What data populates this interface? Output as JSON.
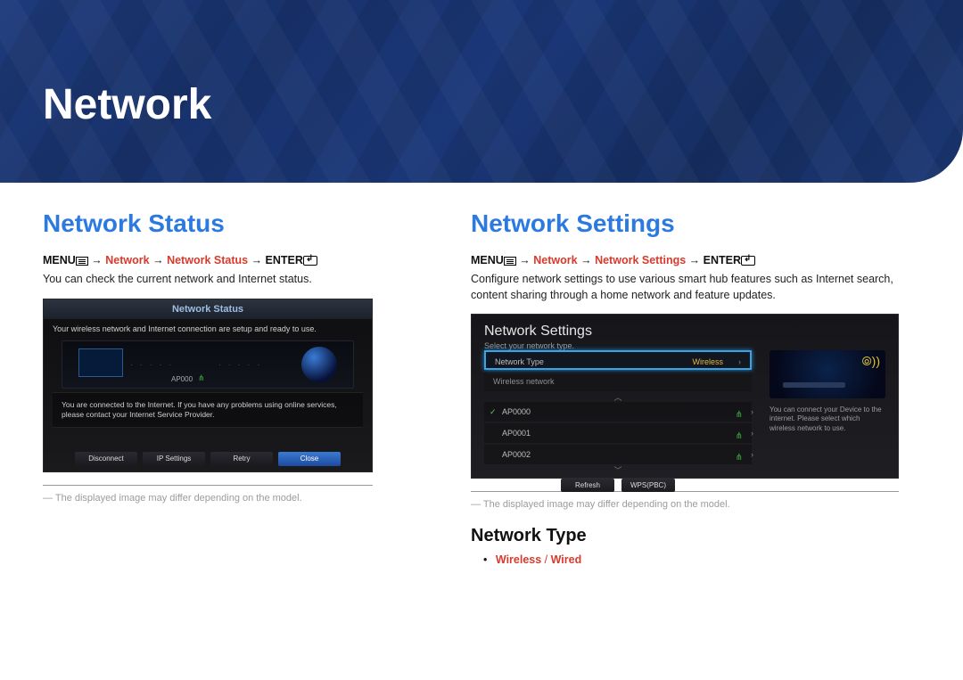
{
  "chapter": {
    "title": "Network"
  },
  "status": {
    "heading": "Network Status",
    "nav": {
      "prefix": "MENU",
      "arrow1": " → ",
      "path1": "Network",
      "arrow2": " → ",
      "path2": "Network Status",
      "arrow3": " → ",
      "suffix": "ENTER"
    },
    "desc": "You can check the current network and Internet status.",
    "screenshot": {
      "title": "Network Status",
      "msg1": "Your wireless network and Internet connection are setup and ready to use.",
      "ap_label": "AP000",
      "msg2": "You are connected to the Internet. If you have any problems using online services, please contact your Internet Service Provider.",
      "buttons": {
        "disconnect": "Disconnect",
        "ip_settings": "IP Settings",
        "retry": "Retry",
        "close": "Close"
      }
    },
    "disclaimer": "― The displayed image may differ depending on the model."
  },
  "settings": {
    "heading": "Network Settings",
    "nav": {
      "prefix": "MENU",
      "arrow1": " → ",
      "path1": "Network",
      "arrow2": " → ",
      "path2": "Network Settings",
      "arrow3": " → ",
      "suffix": "ENTER"
    },
    "desc": "Configure network settings to use various smart hub features such as Internet search, content sharing through a home network and feature updates.",
    "screenshot": {
      "title": "Network Settings",
      "sub": "Select your network type.",
      "type_row": {
        "label": "Network Type",
        "value": "Wireless"
      },
      "list_header": "Wireless network",
      "items": [
        {
          "name": "AP0000",
          "checked": true
        },
        {
          "name": "AP0001",
          "checked": false
        },
        {
          "name": "AP0002",
          "checked": false
        }
      ],
      "info": "You can connect your Device to the internet. Please select which wireless network to use.",
      "buttons": {
        "refresh": "Refresh",
        "wps": "WPS(PBC)"
      }
    },
    "disclaimer": "― The displayed image may differ depending on the model.",
    "type_section": {
      "heading": "Network Type",
      "opt_wireless": "Wireless",
      "sep": " / ",
      "opt_wired": "Wired"
    }
  }
}
